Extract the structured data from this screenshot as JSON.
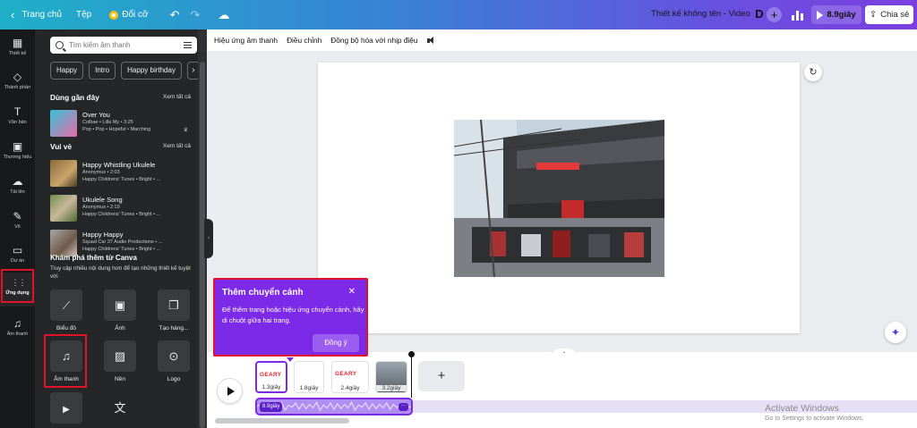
{
  "topbar": {
    "home": "Trang chủ",
    "file": "Tệp",
    "resize": "Đổi cỡ",
    "design_title": "Thiết kế không tên - Video",
    "avatar_letter": "D",
    "play_duration": "8.9giây",
    "share": "Chia sẻ"
  },
  "rail": [
    {
      "label": "Thiết kế",
      "icon": "layout-icon",
      "glyph": "▦"
    },
    {
      "label": "Thành phần",
      "icon": "elements-icon",
      "glyph": "◇"
    },
    {
      "label": "Văn bản",
      "icon": "text-icon",
      "glyph": "T"
    },
    {
      "label": "Thương hiệu",
      "icon": "brand-icon",
      "glyph": "▣"
    },
    {
      "label": "Tải lên",
      "icon": "upload-icon",
      "glyph": "☁"
    },
    {
      "label": "Vẽ",
      "icon": "draw-icon",
      "glyph": "✎"
    },
    {
      "label": "Dự án",
      "icon": "folder-icon",
      "glyph": "▭"
    },
    {
      "label": "Ứng dụng",
      "icon": "apps-grid-icon",
      "glyph": "⋮⋮"
    },
    {
      "label": "Âm thanh",
      "icon": "music-icon",
      "glyph": "♫"
    }
  ],
  "panel": {
    "search_placeholder": "Tìm kiếm âm thanh",
    "chips": [
      "Happy",
      "Intro",
      "Happy birthday"
    ],
    "recent_heading": "Dùng gần đây",
    "see_all": "Xem tất cả",
    "recent_tracks": [
      {
        "title": "Over You",
        "artist": "Colbae • Lilla My • 3:25",
        "genres": "Pop • Pop • Hopeful • Marching"
      }
    ],
    "fun_heading": "Vui vẻ",
    "fun_tracks": [
      {
        "title": "Happy Whistling Ukulele",
        "artist": "Anonymus • 2:03",
        "genres": "Happy Childrens' Tunes • Bright • ..."
      },
      {
        "title": "Ukulele Song",
        "artist": "Anonymus • 2:19",
        "genres": "Happy Childrens' Tunes • Bright • ..."
      },
      {
        "title": "Happy Happy",
        "artist": "Squad Car 37 Audio Productions • ...",
        "genres": "Happy Childrens' Tunes • Bright • ..."
      }
    ],
    "explore_heading": "Khám phá thêm từ Canva",
    "explore_desc": "Truy cập nhiều nội dung hơn để tạo những thiết kế tuyệt vời",
    "apps": [
      {
        "label": "Biểu đồ",
        "icon": "chart-icon",
        "glyph": "📈"
      },
      {
        "label": "Ảnh",
        "icon": "image-icon",
        "glyph": "🖼"
      },
      {
        "label": "Tạo hàng...",
        "icon": "copy-icon",
        "glyph": "❐"
      },
      {
        "label": "Âm thanh",
        "icon": "music-note-icon",
        "glyph": "♫"
      },
      {
        "label": "Nền",
        "icon": "background-icon",
        "glyph": "▨"
      },
      {
        "label": "Logo",
        "icon": "logo-icon",
        "glyph": "⊙"
      },
      {
        "label": "",
        "icon": "video-icon",
        "glyph": "▶"
      },
      {
        "label": "",
        "icon": "translate-icon",
        "glyph": "文"
      }
    ]
  },
  "editor_toolbar": [
    "Hiệu ứng âm thanh",
    "Điều chỉnh",
    "Đồng bộ hóa với nhịp điệu"
  ],
  "popup": {
    "title": "Thêm chuyển cảnh",
    "body": "Để thêm trang hoặc hiệu ứng chuyển cảnh, hãy di chuột giữa hai trang.",
    "button": "Đồng ý"
  },
  "timeline": {
    "clips": [
      "1.3giây",
      "1.8giây",
      "2.4giây",
      "3.2giây"
    ],
    "clip_logo": "GEARY",
    "audio_duration": "8.9giây"
  },
  "watermark": {
    "line1": "Activate Windows",
    "line2": "Go to Settings to activate Windows."
  },
  "colors": {
    "accent": "#7d2ae8",
    "highlight": "#e1122a",
    "panel_bg": "#252627",
    "rail_bg": "#18191b"
  }
}
